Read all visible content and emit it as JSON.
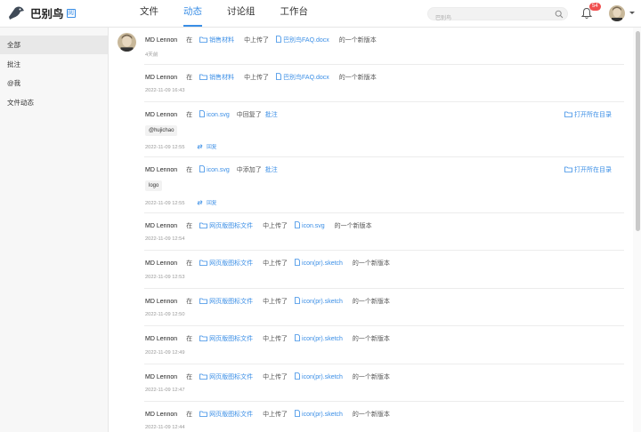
{
  "app": {
    "name": "巴别鸟",
    "badge": "阅"
  },
  "nav": {
    "items": [
      "文件",
      "动态",
      "讨论组",
      "工作台"
    ],
    "active_index": 1
  },
  "search": {
    "placeholder": "巴别鸟"
  },
  "notifications": {
    "count": "54"
  },
  "sidebar": {
    "items": [
      "全部",
      "批注",
      "@我",
      "文件动态"
    ],
    "active_index": 0
  },
  "feed": {
    "open_dir_label": "打开所在目录",
    "reply_label": "回复",
    "in_word": "在",
    "suffix": "的一个新版本",
    "items": [
      {
        "author": "MD Lennon",
        "folder": "销售材料",
        "action": "中上传了",
        "file": "巴别鸟FAQ.docx",
        "suffix": "的一个新版本",
        "time": "4天前"
      },
      {
        "author": "MD Lennon",
        "folder": "销售材料",
        "action": "中上传了",
        "file": "巴别鸟FAQ.docx",
        "suffix": "的一个新版本",
        "time": "2022-11-09 16:43"
      },
      {
        "author": "MD Lennon",
        "file": "icon.svg",
        "action": "中回复了",
        "target": "批注",
        "tag": "@hujichao",
        "time": "2022-11-09 12:55",
        "reply": "回复",
        "open_dir": "打开所在目录"
      },
      {
        "author": "MD Lennon",
        "file": "icon.svg",
        "action": "中添加了",
        "target": "批注",
        "tag": "logo",
        "time": "2022-11-09 12:55",
        "reply": "回复",
        "open_dir": "打开所在目录"
      },
      {
        "author": "MD Lennon",
        "folder": "网页版图标文件",
        "action": "中上传了",
        "file": "icon.svg",
        "suffix": "的一个新版本",
        "time": "2022-11-09 12:54"
      },
      {
        "author": "MD Lennon",
        "folder": "网页版图标文件",
        "action": "中上传了",
        "file": "icon(pr).sketch",
        "suffix": "的一个新版本",
        "time": "2022-11-09 12:53"
      },
      {
        "author": "MD Lennon",
        "folder": "网页版图标文件",
        "action": "中上传了",
        "file": "icon(pr).sketch",
        "suffix": "的一个新版本",
        "time": "2022-11-09 12:50"
      },
      {
        "author": "MD Lennon",
        "folder": "网页版图标文件",
        "action": "中上传了",
        "file": "icon(pr).sketch",
        "suffix": "的一个新版本",
        "time": "2022-11-09 12:49"
      },
      {
        "author": "MD Lennon",
        "folder": "网页版图标文件",
        "action": "中上传了",
        "file": "icon(pr).sketch",
        "suffix": "的一个新版本",
        "time": "2022-11-09 12:47"
      },
      {
        "author": "MD Lennon",
        "folder": "网页版图标文件",
        "action": "中上传了",
        "file": "icon(pr).sketch",
        "suffix": "的一个新版本",
        "time": "2022-11-09 12:44"
      }
    ]
  },
  "colors": {
    "accent": "#3a8ee6",
    "badge_red": "#f04e4e",
    "sidebar_bg": "#f7f7f7"
  }
}
